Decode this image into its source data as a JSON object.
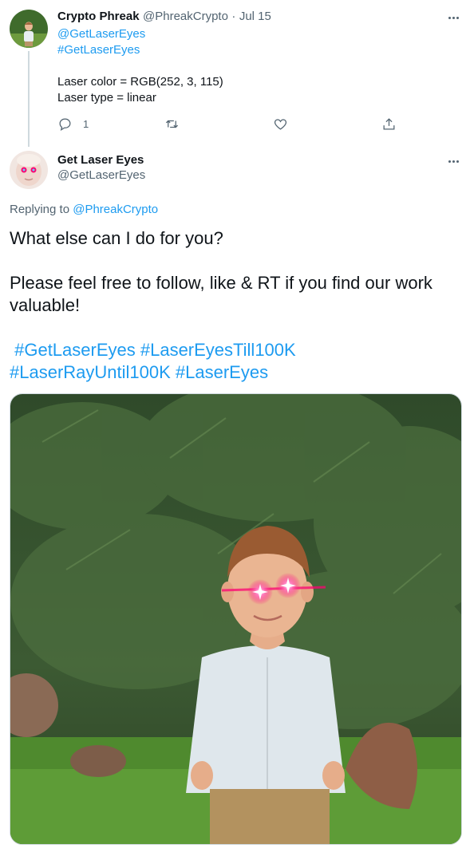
{
  "parent_tweet": {
    "display_name": "Crypto Phreak",
    "handle": "@PhreakCrypto",
    "separator": "·",
    "date": "Jul 15",
    "mention": "@GetLaserEyes",
    "hashtag": "#GetLaserEyes",
    "line_color": "Laser color = RGB(252, 3, 115)",
    "line_type": "Laser type = linear",
    "reply_count": "1"
  },
  "reply_tweet": {
    "display_name": "Get Laser Eyes",
    "handle": "@GetLaserEyes",
    "replying_prefix": "Replying to",
    "replying_handle": "@PhreakCrypto",
    "para1": "What else can I do for you?",
    "para2": "Please feel free to follow, like & RT if you find our work valuable!",
    "hashtags_line1": [
      " #GetLaserEyes",
      " #LaserEyesTill100K"
    ],
    "hashtags_line2": [
      "#LaserRayUntil100K",
      " #LaserEyes"
    ]
  },
  "icons": {
    "more": "more-horizontal-icon",
    "reply": "reply-bubble-icon",
    "retweet": "retweet-icon",
    "like": "heart-icon",
    "share": "share-upload-icon"
  },
  "colors": {
    "link": "#1d9bf0",
    "muted": "#536471",
    "laser": "#fc0373"
  }
}
